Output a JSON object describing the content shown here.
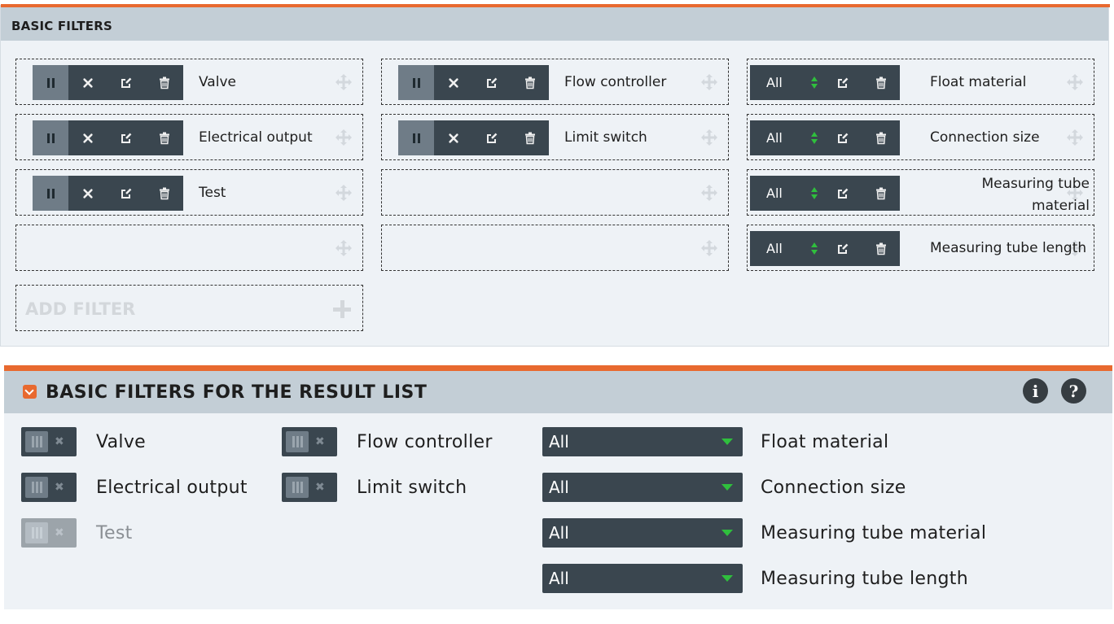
{
  "editor": {
    "title": "BASIC FILTERS",
    "add_filter_label": "ADD FILTER",
    "column1": [
      {
        "label": "Valve"
      },
      {
        "label": "Electrical output"
      },
      {
        "label": "Test"
      }
    ],
    "column2": [
      {
        "label": "Flow controller"
      },
      {
        "label": "Limit switch"
      }
    ],
    "column3": [
      {
        "select_value": "All",
        "label": "Float material"
      },
      {
        "select_value": "All",
        "label": "Connection size"
      },
      {
        "select_value": "All",
        "label": "Measuring tube material"
      },
      {
        "select_value": "All",
        "label": "Measuring tube length"
      }
    ]
  },
  "result": {
    "title": "BASIC FILTERS FOR THE RESULT LIST",
    "info_label": "i",
    "help_label": "?",
    "toggles_col1": [
      {
        "label": "Valve",
        "enabled": true
      },
      {
        "label": "Electrical output",
        "enabled": true
      },
      {
        "label": "Test",
        "enabled": false
      }
    ],
    "toggles_col2": [
      {
        "label": "Flow controller",
        "enabled": true
      },
      {
        "label": "Limit switch",
        "enabled": true
      }
    ],
    "selects": [
      {
        "value": "All",
        "label": "Float material"
      },
      {
        "value": "All",
        "label": "Connection size"
      },
      {
        "value": "All",
        "label": "Measuring tube material"
      },
      {
        "value": "All",
        "label": "Measuring tube length"
      }
    ]
  },
  "colors": {
    "accent": "#e8692f",
    "header_bg": "#c3ced6",
    "panel_bg": "#eef2f6",
    "control_bg": "#3a464f",
    "arrow_green": "#2fbf3d"
  },
  "icons": {
    "pause": "pause-icon",
    "remove": "x-icon",
    "edit": "edit-icon",
    "delete": "trash-icon",
    "move": "move-icon",
    "add": "plus-icon",
    "collapse": "chevron-down-icon",
    "info": "info-icon",
    "help": "help-icon"
  }
}
